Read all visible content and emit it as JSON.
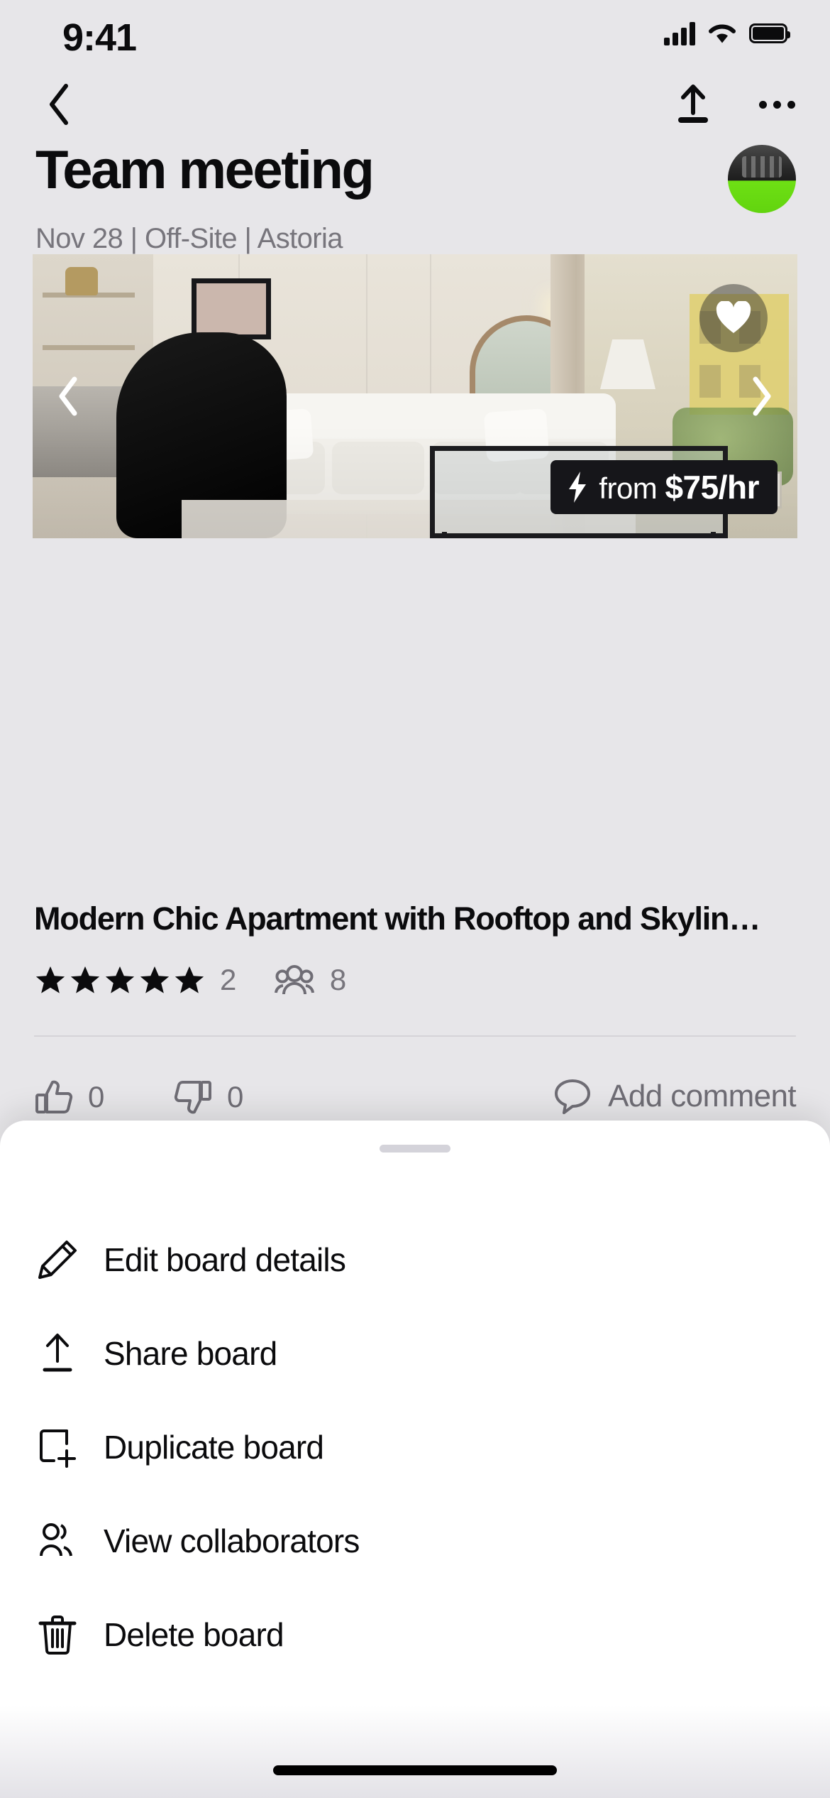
{
  "status_bar": {
    "time": "9:41",
    "cellular_icon": "cellular-bars-icon",
    "wifi_icon": "wifi-icon",
    "battery_icon": "battery-full-icon"
  },
  "nav_bar": {
    "back_icon": "chevron-left-icon",
    "share_icon": "share-upload-icon",
    "more_icon": "more-horizontal-icon"
  },
  "header": {
    "title": "Team meeting",
    "subtitle": "Nov 28 | Off-Site | Astoria",
    "avatar_name": "owner-avatar"
  },
  "listing": {
    "title": "Modern Chic Apartment with Rooftop and Skylin…",
    "price_prefix": "from",
    "price_value": "$75/hr",
    "price_icon": "lightning-bolt-icon",
    "favorite_icon": "heart-icon",
    "prev_icon": "chevron-left-icon",
    "next_icon": "chevron-right-icon",
    "rating_stars": 5,
    "review_count": "2",
    "capacity_icon": "people-group-icon",
    "capacity_count": "8"
  },
  "reactions": {
    "thumbs_up_icon": "thumbs-up-icon",
    "thumbs_up_count": "0",
    "thumbs_down_icon": "thumbs-down-icon",
    "thumbs_down_count": "0",
    "comment_icon": "comment-bubble-icon",
    "comment_label": "Add comment"
  },
  "sheet": {
    "items": [
      {
        "label": "Edit board details",
        "icon": "pencil-icon"
      },
      {
        "label": "Share board",
        "icon": "share-upload-icon"
      },
      {
        "label": "Duplicate board",
        "icon": "duplicate-plus-icon"
      },
      {
        "label": "View collaborators",
        "icon": "people-group-icon"
      },
      {
        "label": "Delete board",
        "icon": "trash-icon"
      }
    ]
  },
  "colors": {
    "background": "#e7e6e9",
    "sheet": "#ffffff",
    "text_primary": "#0b0b0d",
    "text_secondary": "#77757c",
    "badge_background": "#16161a",
    "avatar_accent": "#6ee014"
  }
}
